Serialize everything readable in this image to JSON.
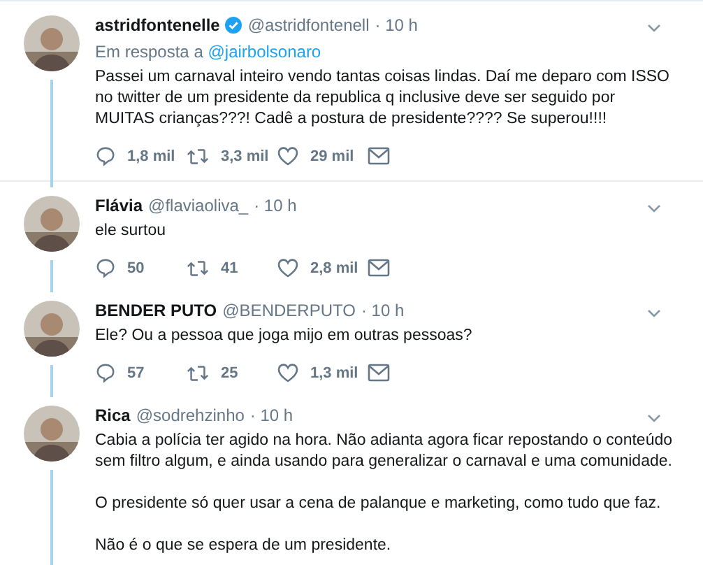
{
  "tweets": [
    {
      "name": "astridfontenelle",
      "verified": true,
      "handle": "@astridfontenell",
      "time": "· 10 h",
      "reply_label": "Em resposta a",
      "reply_to": "@jairbolsonaro",
      "paragraphs": [
        "Passei um carnaval inteiro vendo tantas coisas lindas. Daí me deparo com ISSO no twitter de um presidente da republica q inclusive deve ser seguido por MUITAS crianças???! Cadê a postura de presidente???? Se superou!!!!"
      ],
      "actions": {
        "replies": "1,8 mil",
        "retweets": "3,3 mil",
        "likes": "29 mil"
      }
    },
    {
      "name": "Flávia",
      "verified": false,
      "handle": "@flaviaoliva_",
      "time": "· 10 h",
      "paragraphs": [
        "ele surtou"
      ],
      "actions": {
        "replies": "50",
        "retweets": "41",
        "likes": "2,8 mil"
      }
    },
    {
      "name": "BENDER PUTO",
      "verified": false,
      "handle": "@BENDERPUTO",
      "time": "· 10 h",
      "paragraphs": [
        "Ele? Ou a pessoa que joga mijo em outras pessoas?"
      ],
      "actions": {
        "replies": "57",
        "retweets": "25",
        "likes": "1,3 mil"
      }
    },
    {
      "name": "Rica",
      "verified": false,
      "handle": "@sodrehzinho",
      "time": "· 10 h",
      "paragraphs": [
        "Cabia a polícia ter agido na hora. Não adianta agora ficar repostando o conteúdo sem filtro algum, e ainda usando para generalizar o carnaval e uma comunidade.",
        "O presidente só quer usar a cena de palanque e marketing, como tudo que faz.",
        "Não é o que se espera de um presidente."
      ]
    }
  ]
}
